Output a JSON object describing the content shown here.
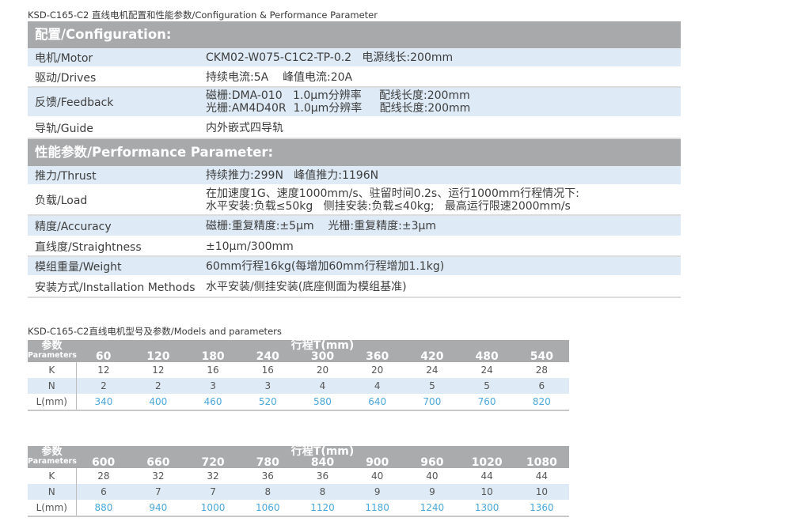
{
  "caption_config": "KSD-C165-C2 直线电机配置和性能参数/Configuration & Performance Parameter",
  "config": {
    "section1_title": "配置/Configuration:",
    "rows1": [
      {
        "label": "电机/Motor",
        "lines": [
          "CKM02-W075-C1C2-TP-0.2   电源线长:200mm"
        ]
      },
      {
        "label": "驱动/Drives",
        "lines": [
          "持续电流:5A    峰值电流:20A"
        ]
      },
      {
        "label": "反馈/Feedback",
        "lines": [
          "磁栅:DMA-010   1.0μm分辨率     配线长度:200mm",
          "光栅:AM4D40R  1.0μm分辨率     配线长度:200mm"
        ]
      },
      {
        "label": "导轨/Guide",
        "lines": [
          "内外嵌式四导轨"
        ]
      }
    ],
    "section2_title": "性能参数/Performance Parameter:",
    "rows2": [
      {
        "label": "推力/Thrust",
        "lines": [
          "持续推力:299N   峰值推力:1196N"
        ]
      },
      {
        "label": "负载/Load",
        "lines": [
          "在加速度1G、速度1000mm/s、驻留时间0.2s、运行1000mm行程情况下:",
          "水平安装:负载≤50kg   侧挂安装:负载≤40kg;   最高运行限速2000mm/s"
        ]
      },
      {
        "label": "精度/Accuracy",
        "lines": [
          "磁栅:重复精度:±5μm    光栅:重复精度:±3μm"
        ]
      },
      {
        "label": "直线度/Straightness",
        "lines": [
          "±10μm/300mm"
        ]
      },
      {
        "label": "模组重量/Weight",
        "lines": [
          "60mm行程16kg(每增加60mm行程增加1.1kg)"
        ]
      },
      {
        "label": "安装方式/Installation Methods",
        "lines": [
          "水平安装/侧挂安装(底座侧面为模组基准)"
        ]
      }
    ]
  },
  "caption_models": "KSD-C165-C2直线电机型号及参数/Models and parameters",
  "models": {
    "param_zh": "参数",
    "param_en": "Parameters",
    "stroke_title": "行程T(mm)",
    "tables": [
      {
        "strokes": [
          "60",
          "120",
          "180",
          "240",
          "300",
          "360",
          "420",
          "480",
          "540"
        ],
        "rows": [
          {
            "label": "K",
            "values": [
              "12",
              "12",
              "16",
              "16",
              "20",
              "20",
              "24",
              "24",
              "28"
            ]
          },
          {
            "label": "N",
            "values": [
              "2",
              "2",
              "3",
              "3",
              "4",
              "4",
              "5",
              "5",
              "6"
            ]
          },
          {
            "label": "L(mm)",
            "values": [
              "340",
              "400",
              "460",
              "520",
              "580",
              "640",
              "700",
              "760",
              "820"
            ]
          }
        ]
      },
      {
        "strokes": [
          "600",
          "660",
          "720",
          "780",
          "840",
          "900",
          "960",
          "1020",
          "1080"
        ],
        "rows": [
          {
            "label": "K",
            "values": [
              "28",
              "32",
              "32",
              "36",
              "36",
              "40",
              "40",
              "44",
              "44"
            ]
          },
          {
            "label": "N",
            "values": [
              "6",
              "7",
              "7",
              "8",
              "8",
              "9",
              "9",
              "10",
              "10"
            ]
          },
          {
            "label": "L(mm)",
            "values": [
              "880",
              "940",
              "1000",
              "1060",
              "1120",
              "1180",
              "1240",
              "1300",
              "1360"
            ]
          }
        ]
      }
    ],
    "value_color": "#4aa7db",
    "header_color": "#a9abad",
    "stripe_color": "#deebf6"
  }
}
